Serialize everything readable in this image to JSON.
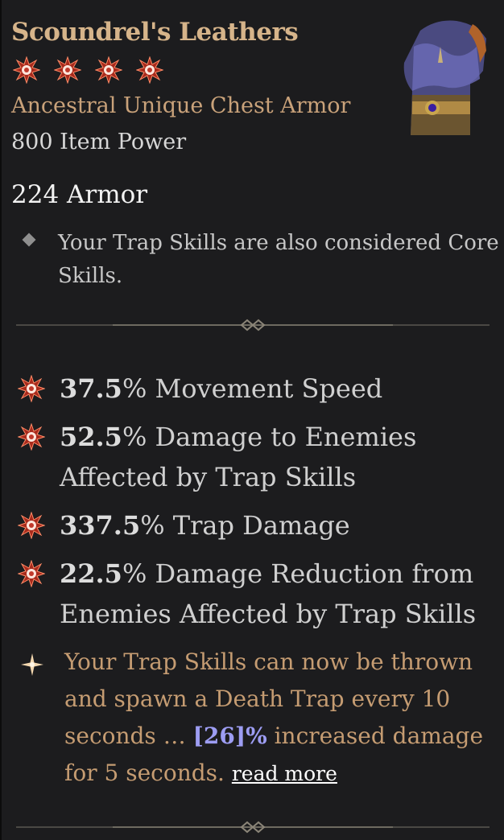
{
  "item": {
    "name": "Scoundrel's Leathers",
    "star_count": 4,
    "type": "Ancestral Unique Chest Armor",
    "power": "800 Item Power",
    "armor": "224 Armor",
    "implicit": "Your Trap Skills are also considered Core Skills."
  },
  "affixes": [
    {
      "value": "37.5",
      "text": "% Movement Speed"
    },
    {
      "value": "52.5",
      "text": "% Damage to Enemies Affected by Trap Skills"
    },
    {
      "value": "337.5",
      "text": "% Trap Damage"
    },
    {
      "value": "22.5",
      "text": "% Damage Reduction from Enemies Affected by Trap Skills"
    }
  ],
  "unique_power": {
    "text_before": "Your Trap Skills can now be thrown and spawn a Death Trap every 10 seconds … ",
    "value": "[26]%",
    "text_after": " increased damage for 5 seconds. ",
    "read_more": "read more"
  },
  "colors": {
    "title": "#d6b48a",
    "subtype": "#c9a27a",
    "unique_text": "#c59c72",
    "value_highlight": "#9d9df3",
    "background": "#1c1c1e"
  },
  "icons": {
    "star": "red-starburst-icon",
    "implicit_bullet": "grey-diamond-icon",
    "affix_bullet": "red-starburst-icon",
    "unique_bullet": "gold-sparkle-icon"
  }
}
